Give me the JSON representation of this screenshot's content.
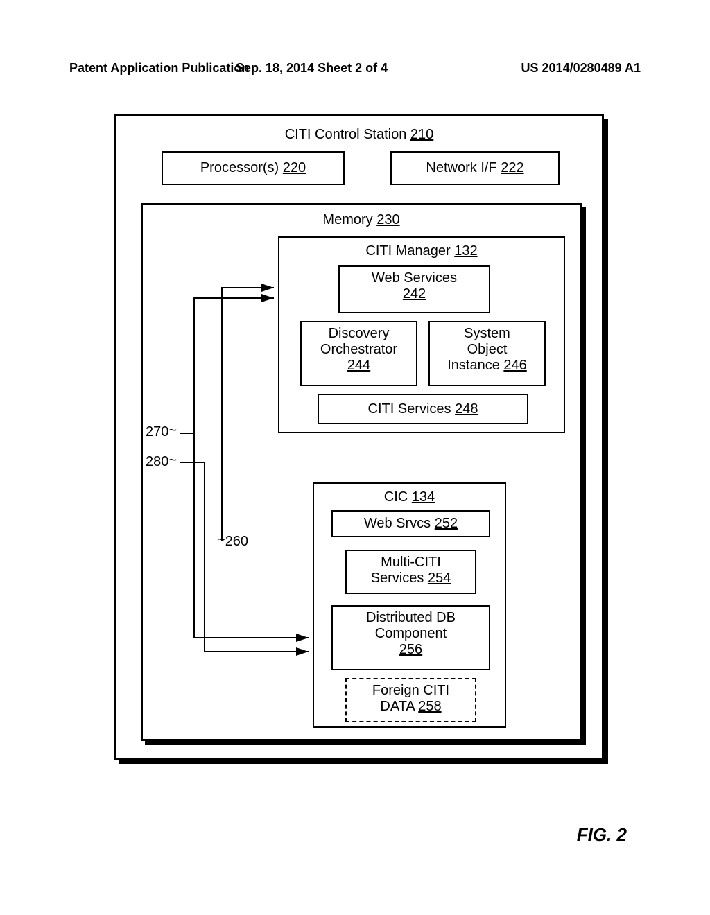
{
  "header": {
    "left": "Patent Application Publication",
    "center": "Sep. 18, 2014  Sheet 2 of 4",
    "right": "US 2014/0280489 A1"
  },
  "outer": {
    "title": "CITI Control Station",
    "num": "210"
  },
  "proc": {
    "title": "Processor(s)",
    "num": "220"
  },
  "nif": {
    "title": "Network I/F",
    "num": "222"
  },
  "memory": {
    "title": "Memory",
    "num": "230"
  },
  "mgr": {
    "title": "CITI Manager",
    "num": "132"
  },
  "websvc": {
    "title": "Web Services",
    "num": "242"
  },
  "disc": {
    "title": "Discovery Orchestrator",
    "num": "244"
  },
  "sysobj": {
    "title": "System Object Instance",
    "num": "246"
  },
  "citisvc": {
    "title": "CITI Services",
    "num": "248"
  },
  "cic": {
    "title": "CIC",
    "num": "134"
  },
  "wsrvcs": {
    "title": "Web Srvcs",
    "num": "252"
  },
  "multi": {
    "title": "Multi-CITI Services",
    "num": "254"
  },
  "ddb": {
    "title": "Distributed DB Component",
    "num": "256"
  },
  "foreign": {
    "title": "Foreign CITI DATA",
    "num": "258"
  },
  "ref260": "260",
  "ref270": "270",
  "ref280": "280",
  "figlabel": "FIG. 2"
}
